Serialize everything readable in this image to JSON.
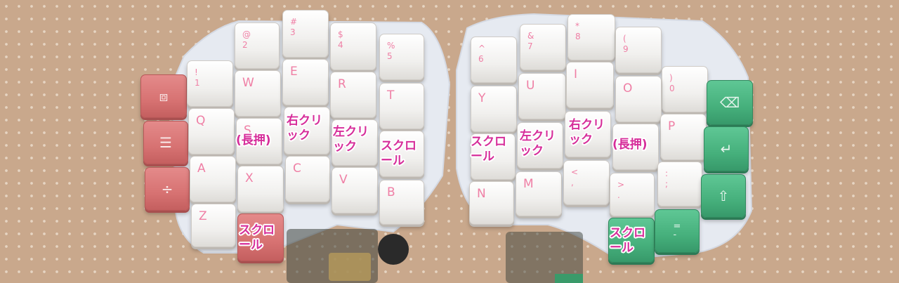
{
  "left_half": {
    "keys": [
      {
        "legend": "@\n2",
        "cls": "small"
      },
      {
        "legend": "#\n3",
        "cls": "small"
      },
      {
        "legend": "$\n4",
        "cls": "small"
      },
      {
        "legend": "%\n5",
        "cls": "small"
      },
      {
        "legend": "!\n1",
        "cls": "small"
      },
      {
        "legend": "W",
        "cls": ""
      },
      {
        "legend": "E",
        "cls": ""
      },
      {
        "legend": "R",
        "cls": ""
      },
      {
        "legend": "T",
        "cls": ""
      },
      {
        "legend": "Q",
        "cls": ""
      },
      {
        "legend": "S",
        "cls": ""
      },
      {
        "legend": "",
        "cls": ""
      },
      {
        "legend": "",
        "cls": ""
      },
      {
        "legend": "",
        "cls": ""
      },
      {
        "legend": "A",
        "cls": ""
      },
      {
        "legend": "",
        "cls": ""
      },
      {
        "legend": "C",
        "cls": ""
      },
      {
        "legend": "V",
        "cls": ""
      },
      {
        "legend": "B",
        "cls": ""
      },
      {
        "legend": "X",
        "cls": ""
      },
      {
        "legend": "Z",
        "cls": ""
      }
    ],
    "mod_icons": [
      "window-icon",
      "menu-icon",
      "divide-icon"
    ],
    "mod_glyphs": [
      "⧈",
      "☰",
      "÷"
    ],
    "labels": [
      "(長押)",
      "右クリ\nック",
      "左クリ\nック",
      "スクロ\nール",
      "スクロ\nール"
    ]
  },
  "right_half": {
    "keys": [
      {
        "legend": "^\n6",
        "cls": "small"
      },
      {
        "legend": "&\n7",
        "cls": "small"
      },
      {
        "legend": "*\n8",
        "cls": "small"
      },
      {
        "legend": "(\n9",
        "cls": "small"
      },
      {
        "legend": ")\n0",
        "cls": "small"
      },
      {
        "legend": "Y",
        "cls": ""
      },
      {
        "legend": "U",
        "cls": ""
      },
      {
        "legend": "I",
        "cls": ""
      },
      {
        "legend": "O",
        "cls": ""
      },
      {
        "legend": "P",
        "cls": ""
      },
      {
        "legend": "",
        "cls": ""
      },
      {
        "legend": "",
        "cls": ""
      },
      {
        "legend": "",
        "cls": ""
      },
      {
        "legend": "",
        "cls": ""
      },
      {
        "legend": ":\n;",
        "cls": "small"
      },
      {
        "legend": "N",
        "cls": ""
      },
      {
        "legend": "M",
        "cls": ""
      },
      {
        "legend": "<\n,",
        "cls": "small"
      },
      {
        "legend": ">\n.",
        "cls": "small"
      }
    ],
    "mod_icons": [
      "backspace-icon",
      "enter-icon",
      "shift-icon",
      "equals-icon"
    ],
    "mod_glyphs": [
      "⌫",
      "↵",
      "⇧",
      "=\n-"
    ],
    "labels": [
      "スクロ\nール",
      "左クリ\nック",
      "右クリ\nック",
      "(長押)",
      "スクロ\nール"
    ]
  },
  "colors": {
    "keycap_white": "#f2f0ee",
    "keycap_pink": "#d77272",
    "keycap_green": "#46b07c",
    "legend_pink": "#ef7fa5",
    "label_magenta": "#d62d9a",
    "case": "#e7ebf2"
  }
}
